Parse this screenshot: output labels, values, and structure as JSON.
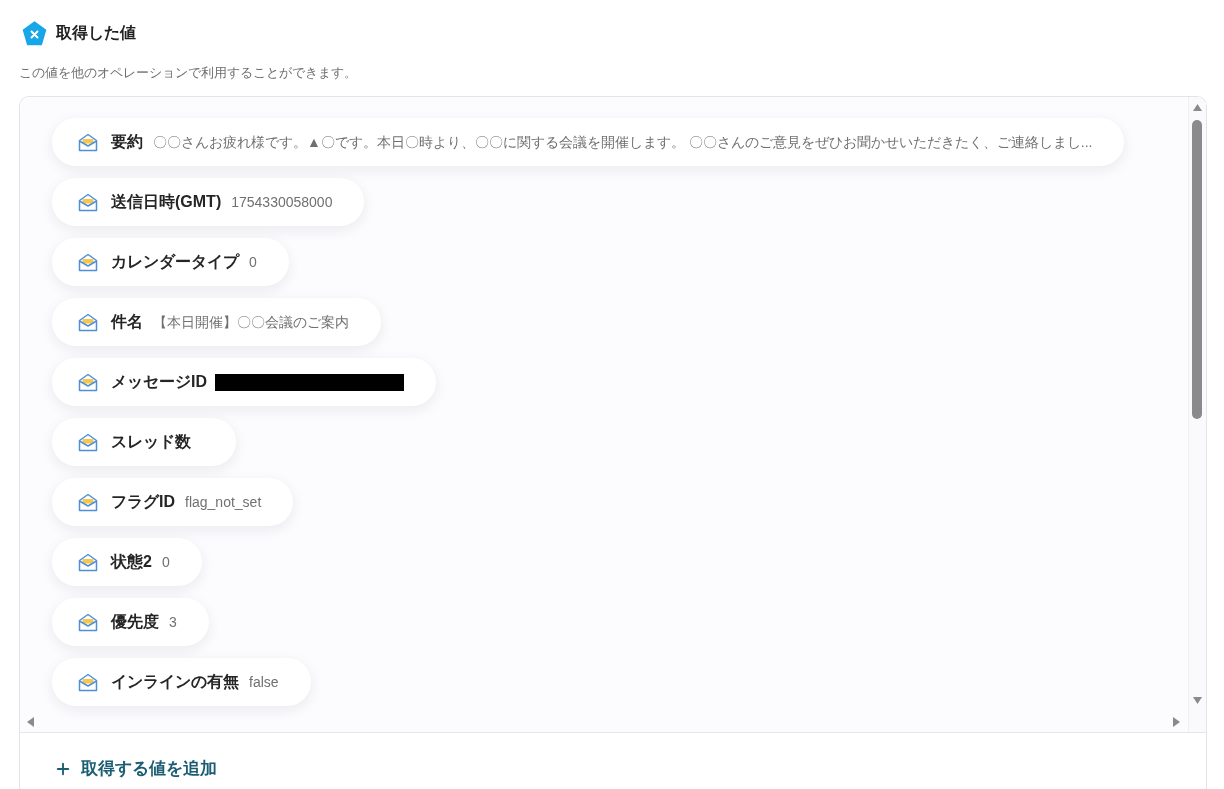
{
  "header": {
    "title": "取得した値",
    "description": "この値を他のオペレーションで利用することができます。"
  },
  "values": [
    {
      "label": "要約",
      "value": "〇〇さんお疲れ様です。▲〇です。本日〇時より、〇〇に関する会議を開催します。 〇〇さんのご意見をぜひお聞かせいただきたく、ご連絡しまし...",
      "redacted": false
    },
    {
      "label": "送信日時(GMT)",
      "value": "1754330058000",
      "redacted": false
    },
    {
      "label": "カレンダータイプ",
      "value": "0",
      "redacted": false
    },
    {
      "label": "件名",
      "value": "【本日開催】〇〇会議のご案内",
      "redacted": false
    },
    {
      "label": "メッセージID",
      "redacted": true
    },
    {
      "label": "スレッド数",
      "redacted": false
    },
    {
      "label": "フラグID",
      "value": "flag_not_set",
      "redacted": false
    },
    {
      "label": "状態2",
      "value": "0",
      "redacted": false
    },
    {
      "label": "優先度",
      "value": "3",
      "redacted": false
    },
    {
      "label": "インラインの有無",
      "value": "false",
      "redacted": false
    }
  ],
  "add_button": {
    "label": "取得する値を追加"
  }
}
